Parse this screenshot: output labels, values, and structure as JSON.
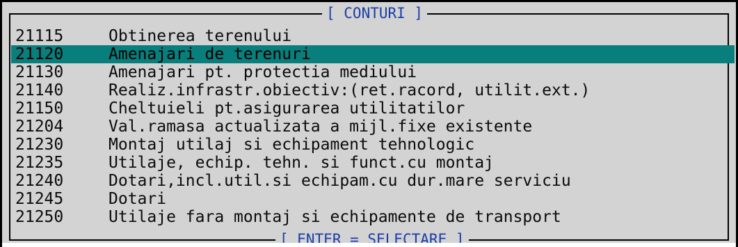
{
  "window": {
    "title": "[ CONTURI ]",
    "footer": "[ ENTER = SELECTARE ]"
  },
  "colors": {
    "background": "#d3d3d3",
    "selection": "#087f7c",
    "title_text": "#1a3ea8",
    "text": "#0b0b0b"
  },
  "accounts": [
    {
      "code": "21115",
      "name": "Obtinerea terenului",
      "selected": false
    },
    {
      "code": "21120",
      "name": "Amenajari de terenuri",
      "selected": true
    },
    {
      "code": "21130",
      "name": "Amenajari pt. protectia mediului",
      "selected": false
    },
    {
      "code": "21140",
      "name": "Realiz.infrastr.obiectiv:(ret.racord, utilit.ext.)",
      "selected": false
    },
    {
      "code": "21150",
      "name": "Cheltuieli pt.asigurarea utilitatilor",
      "selected": false
    },
    {
      "code": "21204",
      "name": "Val.ramasa actualizata a mijl.fixe existente",
      "selected": false
    },
    {
      "code": "21230",
      "name": "Montaj utilaj si echipament tehnologic",
      "selected": false
    },
    {
      "code": "21235",
      "name": "Utilaje, echip. tehn. si funct.cu montaj",
      "selected": false
    },
    {
      "code": "21240",
      "name": "Dotari,incl.util.si echipam.cu dur.mare serviciu",
      "selected": false
    },
    {
      "code": "21245",
      "name": "Dotari",
      "selected": false
    },
    {
      "code": "21250",
      "name": "Utilaje fara montaj si echipamente de transport",
      "selected": false
    }
  ]
}
